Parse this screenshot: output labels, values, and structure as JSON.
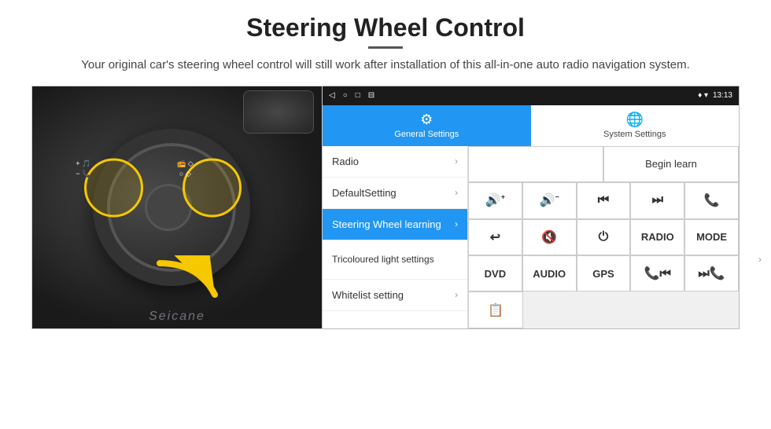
{
  "header": {
    "title": "Steering Wheel Control",
    "subtitle": "Your original car's steering wheel control will still work after installation of this all-in-one auto radio navigation system."
  },
  "status_bar": {
    "time": "13:13",
    "signal_icon": "♦ ▾",
    "nav_back": "◁",
    "nav_home": "○",
    "nav_square": "□",
    "nav_menu": "⊟"
  },
  "tabs": [
    {
      "id": "general",
      "label": "General Settings",
      "icon": "⚙",
      "active": true
    },
    {
      "id": "system",
      "label": "System Settings",
      "icon": "🌐",
      "active": false
    }
  ],
  "menu_items": [
    {
      "label": "Radio",
      "active": false,
      "two_line": false
    },
    {
      "label": "DefaultSetting",
      "active": false,
      "two_line": false
    },
    {
      "label": "Steering Wheel learning",
      "active": true,
      "two_line": false
    },
    {
      "label": "Tricoloured light settings",
      "active": false,
      "two_line": true
    },
    {
      "label": "Whitelist setting",
      "active": false,
      "two_line": false
    }
  ],
  "controls": {
    "begin_learn": "Begin learn",
    "row1": [
      {
        "icon": "🔊+",
        "label": "vol-up"
      },
      {
        "icon": "🔊-",
        "label": "vol-down"
      },
      {
        "icon": "⏮",
        "label": "prev"
      },
      {
        "icon": "⏭",
        "label": "next"
      },
      {
        "icon": "📞",
        "label": "call"
      }
    ],
    "row2": [
      {
        "icon": "↩",
        "label": "back"
      },
      {
        "icon": "🔇",
        "label": "mute"
      },
      {
        "icon": "⏻",
        "label": "power"
      },
      {
        "text": "RADIO",
        "label": "radio"
      },
      {
        "text": "MODE",
        "label": "mode"
      }
    ],
    "row3": [
      {
        "text": "DVD",
        "label": "dvd"
      },
      {
        "text": "AUDIO",
        "label": "audio"
      },
      {
        "text": "GPS",
        "label": "gps"
      },
      {
        "icon": "📞⏮",
        "label": "call-prev"
      },
      {
        "icon": "⏭📞",
        "label": "call-next"
      }
    ],
    "row4": [
      {
        "icon": "📋",
        "label": "list"
      }
    ]
  },
  "seicane_watermark": "Seicane"
}
